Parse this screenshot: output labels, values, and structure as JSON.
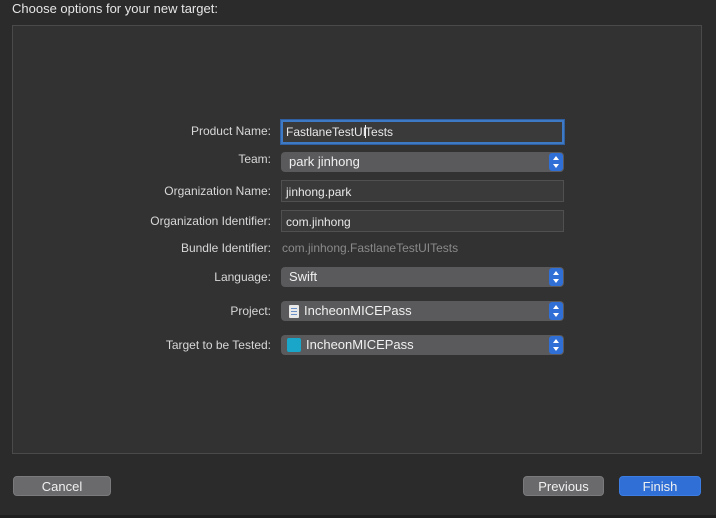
{
  "header": {
    "title": "Choose options for your new target:"
  },
  "form": {
    "product_name": {
      "label": "Product Name:",
      "value_before_caret": "FastlaneTestUI",
      "value_after_caret": "Tests"
    },
    "team": {
      "label": "Team:",
      "value": "park jinhong"
    },
    "organization_name": {
      "label": "Organization Name:",
      "value": "jinhong.park"
    },
    "organization_identifier": {
      "label": "Organization Identifier:",
      "value": "com.jinhong"
    },
    "bundle_identifier": {
      "label": "Bundle Identifier:",
      "value": "com.jinhong.FastlaneTestUITests"
    },
    "language": {
      "label": "Language:",
      "value": "Swift"
    },
    "project": {
      "label": "Project:",
      "value": "IncheonMICEPass",
      "icon": "file-icon"
    },
    "target": {
      "label": "Target to be Tested:",
      "value": "IncheonMICEPass",
      "icon": "app-icon"
    }
  },
  "buttons": {
    "cancel": "Cancel",
    "previous": "Previous",
    "finish": "Finish"
  },
  "colors": {
    "accent": "#2f6fd6",
    "focus_ring": "#3e79c6",
    "background": "#2b2b2c"
  }
}
